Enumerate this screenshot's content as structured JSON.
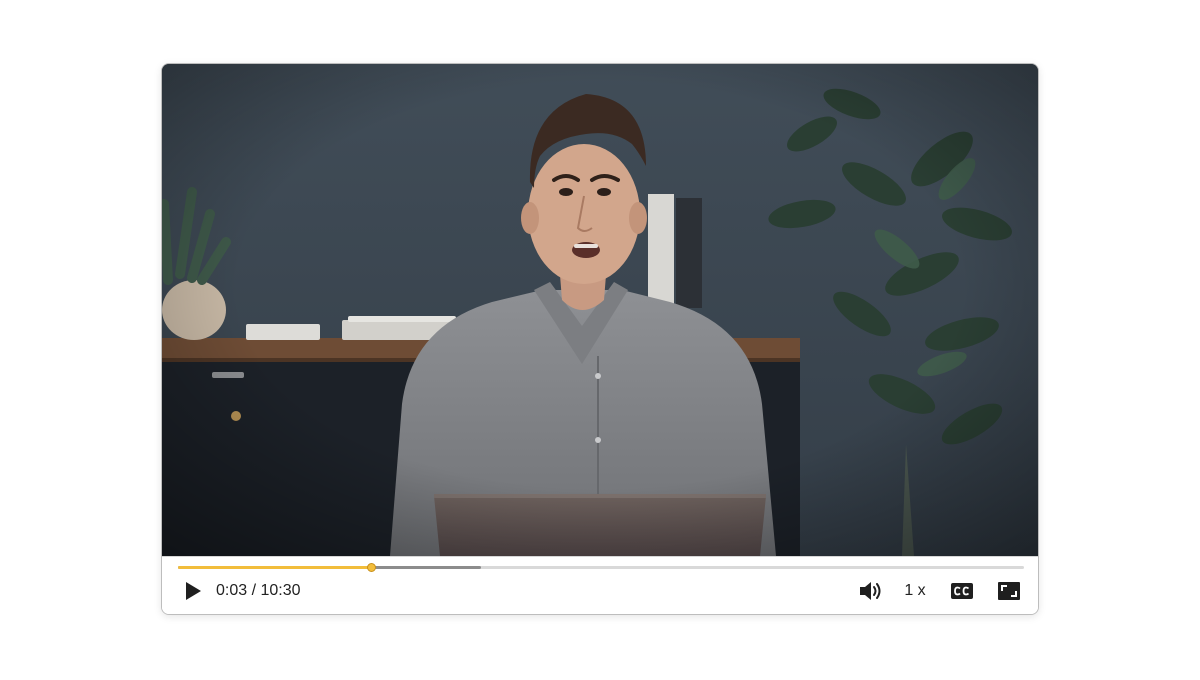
{
  "video": {
    "description_icon": "presenter-video-frame"
  },
  "progress": {
    "played_fraction": 0.228,
    "buffered_fraction": 0.358,
    "colors": {
      "played": "#f2bd3b",
      "buffered": "#8c8c8c",
      "track": "#d9d9d9"
    }
  },
  "controls": {
    "play_icon": "play-icon",
    "time_display": "0:03 / 10:30",
    "volume_icon": "volume-icon",
    "speed_label": "1 x",
    "cc_icon": "closed-captions-icon",
    "fullscreen_icon": "fullscreen-icon"
  }
}
